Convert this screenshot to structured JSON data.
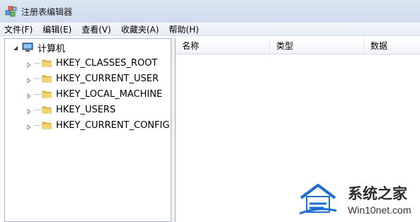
{
  "window": {
    "title": "注册表编辑器"
  },
  "menu": [
    {
      "label": "文件(F)"
    },
    {
      "label": "编辑(E)"
    },
    {
      "label": "查看(V)"
    },
    {
      "label": "收藏夹(A)"
    },
    {
      "label": "帮助(H)"
    }
  ],
  "tree": {
    "root": {
      "label": "计算机",
      "icon": "computer-icon"
    },
    "items": [
      {
        "label": "HKEY_CLASSES_ROOT",
        "icon": "folder-icon"
      },
      {
        "label": "HKEY_CURRENT_USER",
        "icon": "folder-icon"
      },
      {
        "label": "HKEY_LOCAL_MACHINE",
        "icon": "folder-icon"
      },
      {
        "label": "HKEY_USERS",
        "icon": "folder-icon"
      },
      {
        "label": "HKEY_CURRENT_CONFIG",
        "icon": "folder-icon"
      }
    ]
  },
  "list": {
    "columns": [
      {
        "label": "名称"
      },
      {
        "label": "类型"
      },
      {
        "label": "数据"
      }
    ]
  },
  "watermark": {
    "title": "系统之家",
    "subtitle": "Win10net.com"
  },
  "colors": {
    "titlebar": "#cfdced",
    "folder": "#e8c24a",
    "pane_border": "#a9b3c2",
    "watermark_blue": "#1e6fd0"
  }
}
